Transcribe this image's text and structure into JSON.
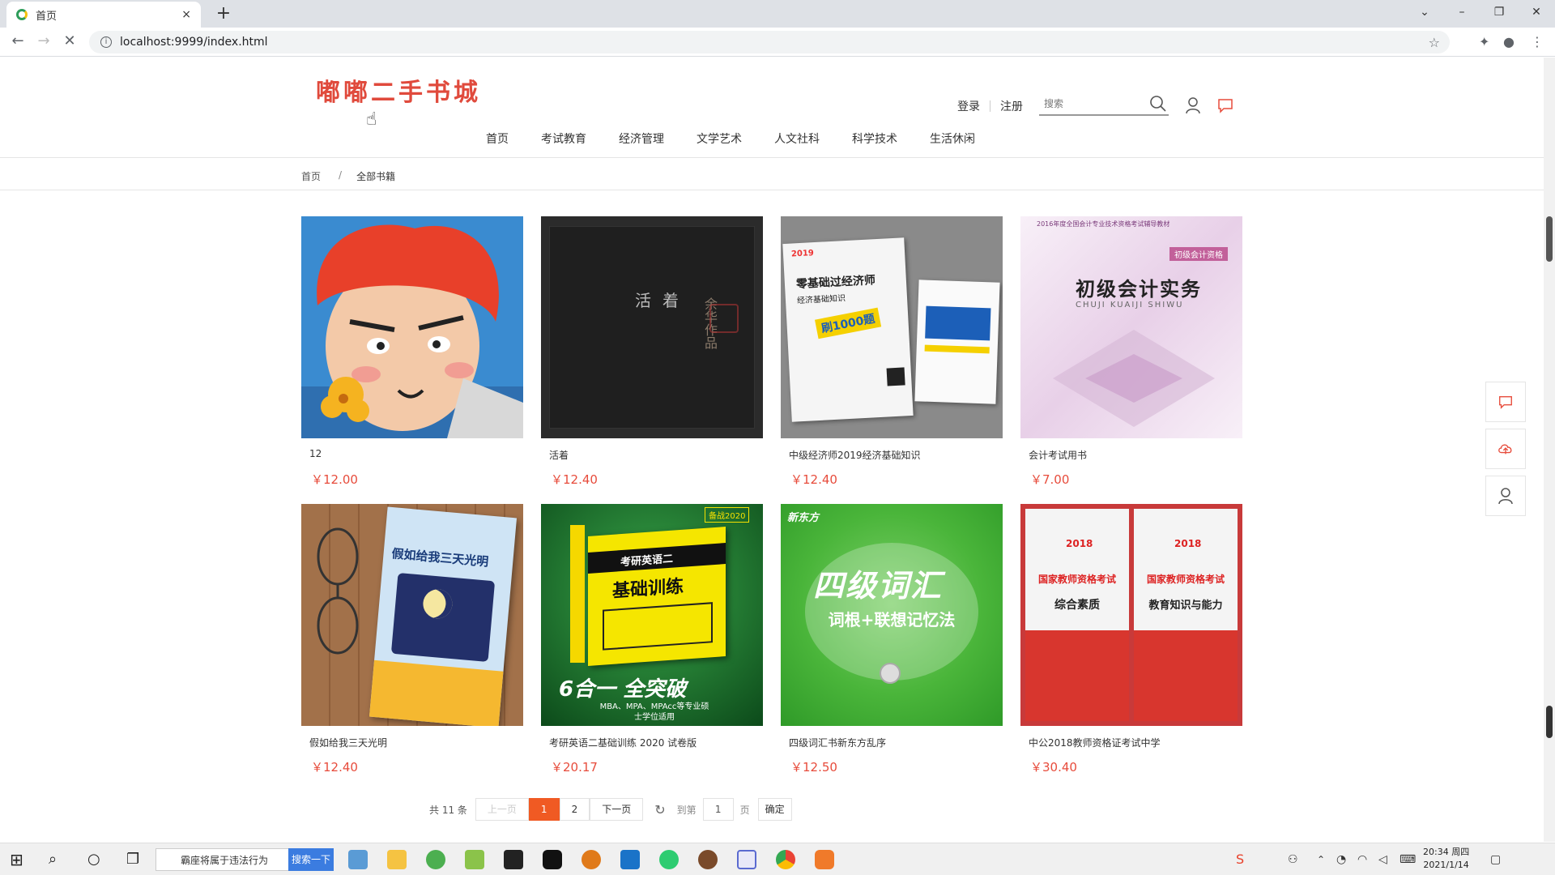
{
  "browser": {
    "tab_title": "首页",
    "tab_close": "×",
    "new_tab": "+",
    "url": "localhost:9999/index.html",
    "win_min": "⌄",
    "win_minimize": "–",
    "win_restore": "❐",
    "win_close": "✕"
  },
  "header": {
    "logo": "嘟嘟二手书城",
    "login": "登录",
    "register": "注册",
    "search_placeholder": "搜索"
  },
  "nav": [
    "首页",
    "考试教育",
    "经济管理",
    "文学艺术",
    "人文社科",
    "科学技术",
    "生活休闲"
  ],
  "breadcrumb": {
    "home": "首页",
    "sep": "/",
    "current": "全部书籍"
  },
  "books": [
    {
      "name": "12",
      "price": "￥12.00"
    },
    {
      "name": "活着",
      "price": "￥12.40"
    },
    {
      "name": "中级经济师2019经济基础知识",
      "price": "￥12.40"
    },
    {
      "name": "会计考试用书",
      "price": "￥7.00"
    },
    {
      "name": "假如给我三天光明",
      "price": "￥12.40"
    },
    {
      "name": "考研英语二基础训练 2020 试卷版",
      "price": "￥20.17"
    },
    {
      "name": "四级词汇书新东方乱序",
      "price": "￥12.50"
    },
    {
      "name": "中公2018教师资格证考试中学",
      "price": "￥30.40"
    }
  ],
  "covers": {
    "c2_title": "活着",
    "c2_author": "余华作品",
    "c3_title": "零基础过经济师",
    "c3_sub": "经济基础知识",
    "c3_badge": "2019",
    "c3_stamp": "刷1000题",
    "c4_year": "2016年度全国会计专业技术资格考试辅导教材",
    "c4_tag": "初级会计资格",
    "c4_title": "初级会计实务",
    "c4_pinyin": "CHUJI KUAIJI SHIWU",
    "c5_title": "假如给我三天光明",
    "c6_badge": "备战2020",
    "c6_title": "考研英语二",
    "c6_sub": "基础训练",
    "c6_bottom": "6合一 全突破",
    "c6_note": "MBA、MPA、MPAcc等专业硕士学位适用",
    "c7_brand": "新东方",
    "c7_title": "四级词汇",
    "c7_sub": "词根+联想记忆法",
    "c8_year": "2018",
    "c8_left": "综合素质",
    "c8_right": "教育知识与能力",
    "c8_head": "国家教师资格考试"
  },
  "pager": {
    "total": "共 11 条",
    "prev": "上一页",
    "page1": "1",
    "page2": "2",
    "next": "下一页",
    "goto": "到第",
    "goto_val": "1",
    "page_unit": "页",
    "confirm": "确定"
  },
  "taskbar": {
    "search_text": "霸座将属于违法行为",
    "search_btn": "搜索一下",
    "time": "20:34 周四",
    "date": "2021/1/14"
  }
}
